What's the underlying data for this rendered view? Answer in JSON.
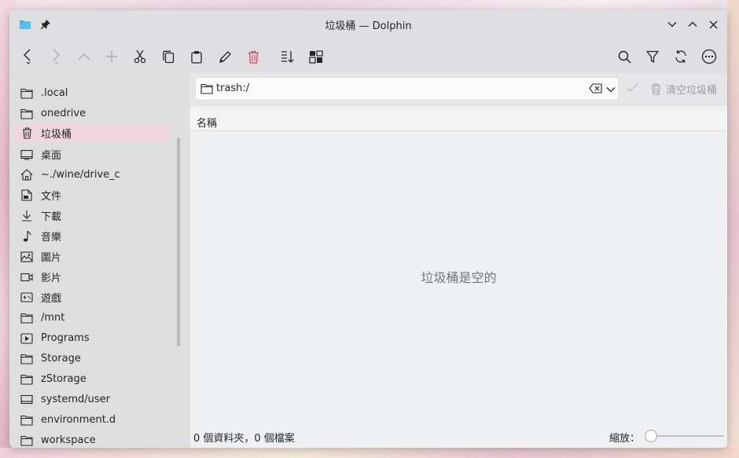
{
  "window": {
    "title": "垃圾桶 — Dolphin",
    "app_icon": "folder-icon",
    "pin_icon": "pin-icon",
    "controls": [
      "minimize",
      "maximize",
      "close"
    ]
  },
  "toolbar": {
    "left": [
      "back",
      "forward",
      "up",
      "new",
      "cut",
      "copy",
      "paste",
      "rename",
      "delete",
      "sort",
      "view-split"
    ],
    "right": [
      "search",
      "filter",
      "reload",
      "more"
    ]
  },
  "sidebar": {
    "items": [
      {
        "label": ".local",
        "icon": "folder-icon"
      },
      {
        "label": "onedrive",
        "icon": "folder-icon"
      },
      {
        "label": "垃圾桶",
        "icon": "trash-icon",
        "active": true
      },
      {
        "label": "桌面",
        "icon": "desktop-icon"
      },
      {
        "label": "~./wine/drive_c",
        "icon": "home-icon"
      },
      {
        "label": "文件",
        "icon": "documents-icon"
      },
      {
        "label": "下載",
        "icon": "download-icon"
      },
      {
        "label": "音樂",
        "icon": "music-icon"
      },
      {
        "label": "圖片",
        "icon": "pictures-icon"
      },
      {
        "label": "影片",
        "icon": "videos-icon"
      },
      {
        "label": "遊戲",
        "icon": "games-icon"
      },
      {
        "label": "/mnt",
        "icon": "folder-icon"
      },
      {
        "label": "Programs",
        "icon": "programs-icon"
      },
      {
        "label": "Storage",
        "icon": "folder-icon"
      },
      {
        "label": "zStorage",
        "icon": "folder-icon"
      },
      {
        "label": "systemd/user",
        "icon": "drive-icon"
      },
      {
        "label": "environment.d",
        "icon": "folder-icon"
      },
      {
        "label": "workspace",
        "icon": "folder-icon"
      }
    ]
  },
  "location": {
    "path": "trash:/",
    "empty_trash_label": "清空垃圾桶"
  },
  "table": {
    "columns": [
      "名稱"
    ]
  },
  "content": {
    "empty_message": "垃圾桶是空的"
  },
  "status": {
    "text": "0 個資料夾，0 個檔案",
    "zoom_label": "縮放：",
    "zoom_level": 0.0
  },
  "colors": {
    "active_item": "#efd6df",
    "delete_icon": "#da4453"
  }
}
